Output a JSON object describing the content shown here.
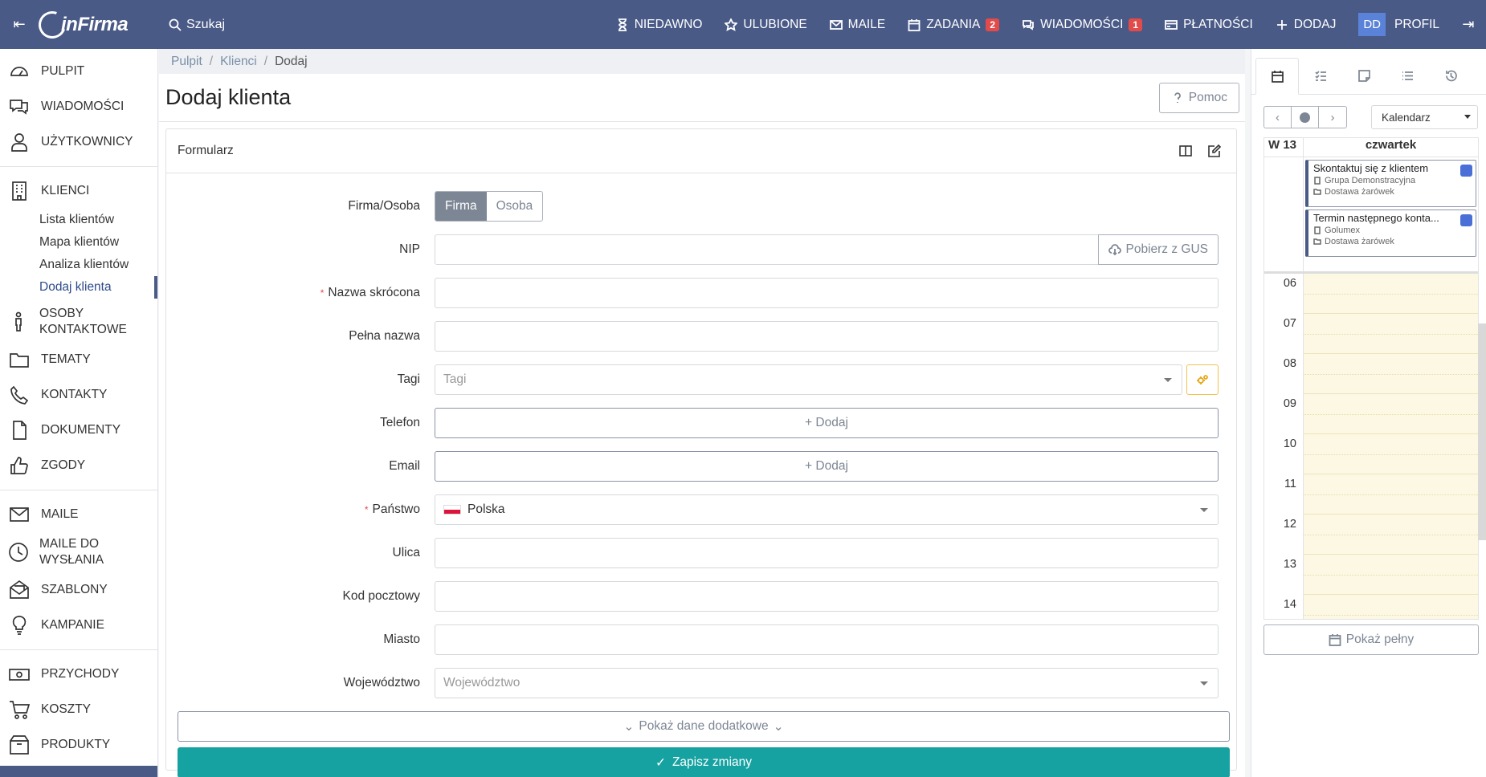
{
  "topbar": {
    "search_label": "Szukaj",
    "nav": [
      {
        "label": "NIEDAWNO",
        "icon": "hourglass-icon"
      },
      {
        "label": "ULUBIONE",
        "icon": "star-icon"
      },
      {
        "label": "MAILE",
        "icon": "envelope-icon"
      },
      {
        "label": "ZADANIA",
        "icon": "calendar-icon",
        "badge": "2"
      },
      {
        "label": "WIADOMOŚCI",
        "icon": "chat-icon",
        "badge": "1"
      },
      {
        "label": "PŁATNOŚCI",
        "icon": "credit-card-icon"
      },
      {
        "label": "DODAJ",
        "icon": "plus-icon"
      }
    ],
    "avatar": "DD",
    "profile_label": "PROFIL"
  },
  "sidebar": {
    "group1": [
      {
        "label": "PULPIT",
        "icon": "gauge-icon"
      },
      {
        "label": "WIADOMOŚCI",
        "icon": "chat-icon"
      },
      {
        "label": "UŻYTKOWNICY",
        "icon": "user-icon"
      }
    ],
    "klienci": {
      "label": "KLIENCI",
      "icon": "building-icon"
    },
    "klienci_sub": [
      "Lista klientów",
      "Mapa klientów",
      "Analiza klientów",
      "Dodaj klienta"
    ],
    "group2": [
      {
        "label": "OSOBY KONTAKTOWE",
        "icon": "person-icon"
      },
      {
        "label": "TEMATY",
        "icon": "folder-icon"
      },
      {
        "label": "KONTAKTY",
        "icon": "phone-icon"
      },
      {
        "label": "DOKUMENTY",
        "icon": "document-icon"
      },
      {
        "label": "ZGODY",
        "icon": "thumbs-up-icon"
      }
    ],
    "group3": [
      {
        "label": "MAILE",
        "icon": "envelope-icon"
      },
      {
        "label": "MAILE DO WYSŁANIA",
        "icon": "clock-icon"
      },
      {
        "label": "SZABLONY",
        "icon": "envelope-open-icon"
      },
      {
        "label": "KAMPANIE",
        "icon": "lightbulb-icon"
      }
    ],
    "group4": [
      {
        "label": "PRZYCHODY",
        "icon": "banknote-icon"
      },
      {
        "label": "KOSZTY",
        "icon": "cart-icon"
      },
      {
        "label": "PRODUKTY",
        "icon": "box-icon"
      }
    ]
  },
  "breadcrumb": [
    "Pulpit",
    "Klienci",
    "Dodaj"
  ],
  "page": {
    "title": "Dodaj klienta",
    "help_label": "Pomoc"
  },
  "card": {
    "title": "Formularz"
  },
  "form": {
    "type_label": "Firma/Osoba",
    "type_options": [
      "Firma",
      "Osoba"
    ],
    "type_selected": "Firma",
    "nip_label": "NIP",
    "gus_button": "Pobierz z GUS",
    "short_name_label": "Nazwa skrócona",
    "full_name_label": "Pełna nazwa",
    "tags_label": "Tagi",
    "tags_placeholder": "Tagi",
    "phone_label": "Telefon",
    "email_label": "Email",
    "add_label": "Dodaj",
    "country_label": "Państwo",
    "country_value": "Polska",
    "street_label": "Ulica",
    "postal_label": "Kod pocztowy",
    "city_label": "Miasto",
    "voivodeship_label": "Województwo",
    "voivodeship_placeholder": "Województwo",
    "more_label": "Pokaż dane dodatkowe",
    "save_label": "Zapisz zmiany"
  },
  "calendar": {
    "view_select": "Kalendarz",
    "week": "W 13",
    "day": "czwartek",
    "events": [
      {
        "title": "Skontaktuj się z klientem",
        "client": "Grupa Demonstracyjna",
        "topic": "Dostawa żarówek"
      },
      {
        "title": "Termin następnego konta...",
        "client": "Golumex",
        "topic": "Dostawa żarówek"
      }
    ],
    "hours": [
      "06",
      "07",
      "08",
      "09",
      "10",
      "11",
      "12",
      "13",
      "14"
    ],
    "show_full_label": "Pokaż pełny"
  },
  "colors": {
    "topbar": "#4a5a87",
    "save": "#17a2a2",
    "badge": "#e34b4b",
    "calendar_bg": "#fcf8e3"
  }
}
